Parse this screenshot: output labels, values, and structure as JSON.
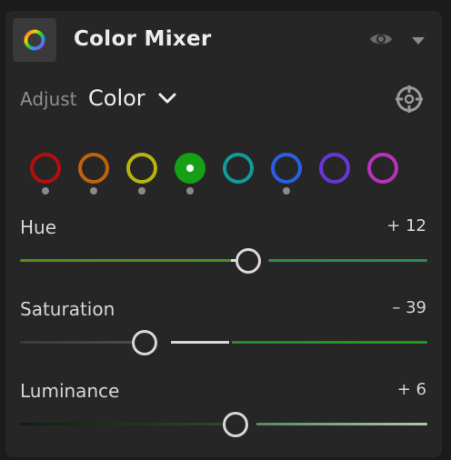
{
  "panel": {
    "title": "Color Mixer",
    "icons": {
      "panel_icon": "color-wheel-icon",
      "visibility": "eye-icon",
      "collapse": "triangle-down-icon"
    }
  },
  "adjust": {
    "label": "Adjust",
    "value": "Color",
    "dropdown_icon": "chevron-down-icon",
    "target_icon": "target-adjustment-icon"
  },
  "color_channels": [
    {
      "name": "red",
      "color": "#b40e0e",
      "selected": false,
      "has_adjustment": true
    },
    {
      "name": "orange",
      "color": "#c0620d",
      "selected": false,
      "has_adjustment": true
    },
    {
      "name": "yellow",
      "color": "#b9b30f",
      "selected": false,
      "has_adjustment": true
    },
    {
      "name": "green",
      "color": "#15a015",
      "selected": true,
      "has_adjustment": true
    },
    {
      "name": "aqua",
      "color": "#119a9a",
      "selected": false,
      "has_adjustment": false
    },
    {
      "name": "blue",
      "color": "#2a5ee6",
      "selected": false,
      "has_adjustment": true
    },
    {
      "name": "purple",
      "color": "#6a35d6",
      "selected": false,
      "has_adjustment": false
    },
    {
      "name": "magenta",
      "color": "#b832b8",
      "selected": false,
      "has_adjustment": false
    }
  ],
  "sliders": {
    "hue": {
      "label": "Hue",
      "value_text": "+ 12",
      "value": 12,
      "min": -100,
      "max": 100
    },
    "saturation": {
      "label": "Saturation",
      "value_text": "– 39",
      "value": -39,
      "min": -100,
      "max": 100
    },
    "luminance": {
      "label": "Luminance",
      "value_text": "+ 6",
      "value": 6,
      "min": -100,
      "max": 100
    }
  },
  "colors": {
    "panel_bg": "#262626",
    "text_primary": "#ececec",
    "text_muted": "#8f8f8f"
  }
}
